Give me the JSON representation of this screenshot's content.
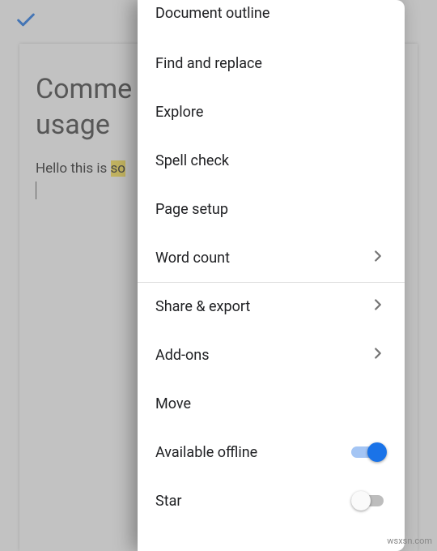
{
  "topbar": {
    "confirm_icon": "check"
  },
  "document": {
    "title_line1": "Comme",
    "title_line2": "usage",
    "body_prefix": "Hello this is ",
    "body_highlight": "so"
  },
  "menu": {
    "items": [
      {
        "label": "Document outline",
        "type": "plain"
      },
      {
        "label": "Find and replace",
        "type": "plain"
      },
      {
        "label": "Explore",
        "type": "plain"
      },
      {
        "label": "Spell check",
        "type": "plain"
      },
      {
        "label": "Page setup",
        "type": "plain"
      },
      {
        "label": "Word count",
        "type": "chevron"
      },
      {
        "label": "Share & export",
        "type": "chevron",
        "divider": true
      },
      {
        "label": "Add-ons",
        "type": "chevron"
      },
      {
        "label": "Move",
        "type": "plain"
      },
      {
        "label": "Available offline",
        "type": "toggle",
        "on": true
      },
      {
        "label": "Star",
        "type": "toggle",
        "on": false
      }
    ]
  },
  "watermark": "wsxsn.com"
}
